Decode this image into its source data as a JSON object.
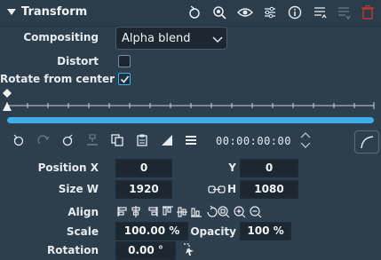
{
  "header": {
    "title": "Transform"
  },
  "compositing": {
    "label": "Compositing",
    "value": "Alpha blend"
  },
  "distort": {
    "label": "Distort",
    "checked": false
  },
  "rotate_center": {
    "label": "Rotate from center",
    "checked": true
  },
  "keyframes": {
    "timecode": "00:00:00:00"
  },
  "position": {
    "label_x": "Position X",
    "x": "0",
    "label_y": "Y",
    "y": "0"
  },
  "size": {
    "label_w": "Size W",
    "w": "1920",
    "label_h": "H",
    "h": "1080"
  },
  "align": {
    "label": "Align"
  },
  "scale": {
    "label": "Scale",
    "value": "100.00 %"
  },
  "opacity": {
    "label": "Opacity",
    "value": "100 %"
  },
  "rotation": {
    "label": "Rotation",
    "value": "0.00 °"
  },
  "colors": {
    "accent": "#3daee9",
    "background": "#2d3e4d",
    "field": "#1c2831",
    "delete": "#c0392b"
  }
}
